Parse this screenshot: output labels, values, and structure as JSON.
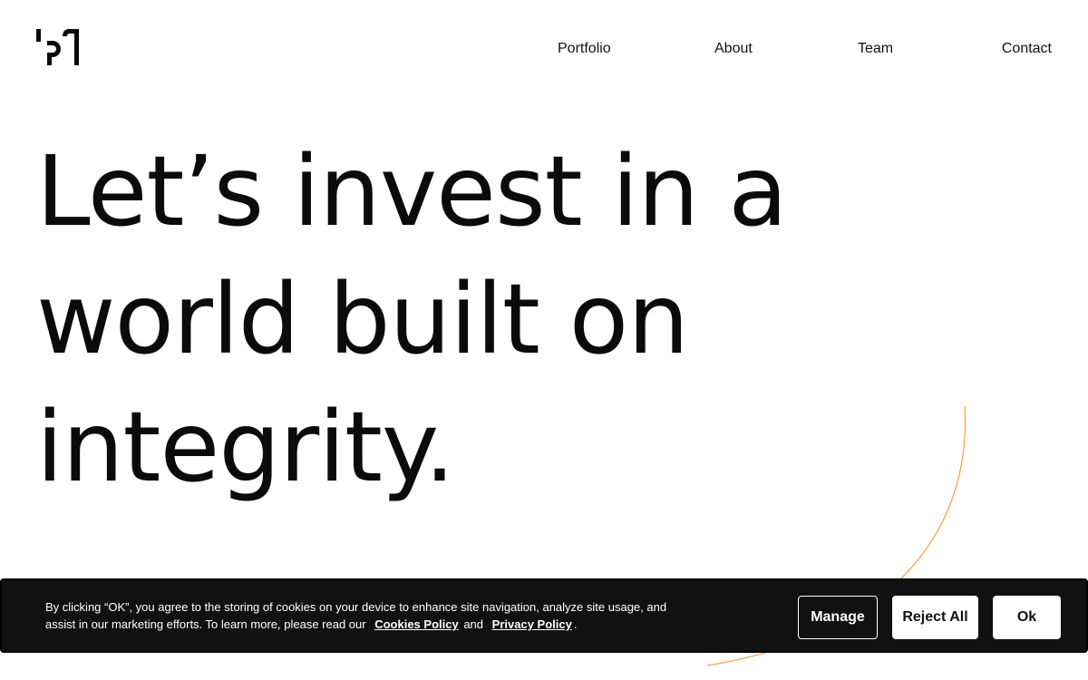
{
  "header": {
    "logo_icon": "bt-monogram-logo",
    "nav": [
      {
        "label": "Portfolio"
      },
      {
        "label": "About"
      },
      {
        "label": "Team"
      },
      {
        "label": "Contact"
      }
    ]
  },
  "hero": {
    "lines": [
      "Let’s invest in a",
      "world built on",
      "integrity."
    ]
  },
  "decor": {
    "arc_color": "#f0a13c"
  },
  "cookie_banner": {
    "text_before": "By clicking “OK”, you agree to the storing of cookies on your device to enhance site navigation, analyze site usage, and assist in our marketing efforts. To learn more, please read our",
    "cookies_link": "Cookies Policy",
    "and_text": "and",
    "privacy_link": "Privacy Policy",
    "period": ".",
    "buttons": {
      "manage": "Manage",
      "reject_all": "Reject All",
      "ok": "Ok"
    }
  }
}
